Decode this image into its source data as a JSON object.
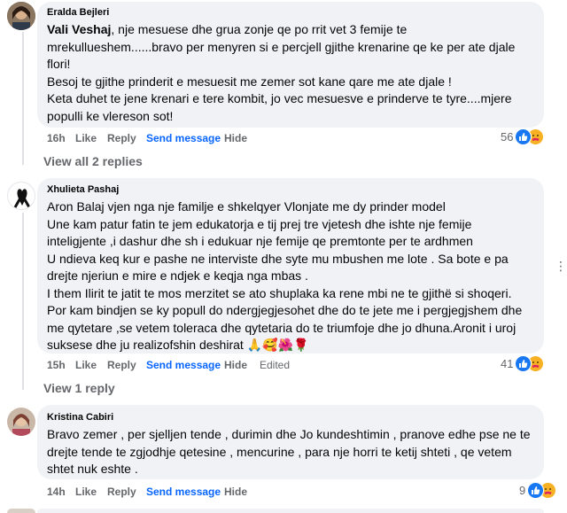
{
  "comments": [
    {
      "author": "Eralda Bejleri",
      "mention": "Vali Veshaj",
      "lines": [
        ", nje mesuese dhe grua zonje qe po rrit vet 3 femije te",
        "mrekullueshem......bravo per menyren si e percjell gjithe krenarine qe ke per ate djale",
        "flori!",
        "Besoj te gjithe prinderit e mesuesit me zemer sot kane qare me ate djale !",
        "Keta duhet te jene krenari e tere kombit, jo vec mesuesve e prinderve te tyre....mjere",
        "populli ke vlereson sot!"
      ],
      "time": "16h",
      "like": "Like",
      "reply": "Reply",
      "send": "Send message",
      "hide": "Hide",
      "reaction_count": "56",
      "reaction_icons": [
        "like-icon",
        "care-icon"
      ],
      "view_replies": "View all 2 replies"
    },
    {
      "author": "Xhulieta Pashaj",
      "lines": [
        "Aron Balaj vjen nga nje familje e shkelqyer Vlonjate me dy prinder model",
        "Une kam patur fatin te jem edukatorja e tij prej tre vjetesh dhe ishte nje femije",
        "inteligjente ,i dashur dhe sh i edukuar nje femije qe premtonte per te ardhmen",
        "U ndieva keq kur e pashe ne interviste dhe syte mu mbushen me lote . Sa bote e pa",
        "drejte njeriun e mire e ndjek e keqja nga mbas .",
        "I them Ilirit te jatit te mos merzitet se ato shuplaka ka rene mbi ne te gjithë si shoqeri.",
        "Por kam bindjen se ky popull do ndergjegjesohet dhe do te jete me i pergjegjshem dhe",
        "me qytetare ,se vetem toleraca dhe qytetaria do te triumfoje dhe jo dhuna.Aronit i uroj",
        "suksese dhe ju realizofshin deshirat 🙏🥰🌺🌹"
      ],
      "time": "15h",
      "like": "Like",
      "reply": "Reply",
      "send": "Send message",
      "hide": "Hide",
      "edited": "Edited",
      "reaction_count": "41",
      "reaction_icons": [
        "like-icon",
        "care-icon"
      ],
      "view_replies": "View 1 reply"
    },
    {
      "author": "Kristina Cabiri",
      "lines": [
        "Bravo zemer , per sjelljen tende , durimin dhe Jo kundeshtimin , pranove edhe pse ne te",
        "drejte tende te zgjodhje qetesine , mencurine , para nje horri te ketij shteti , qe vetem",
        "shtet nuk eshte ."
      ],
      "time": "14h",
      "like": "Like",
      "reply": "Reply",
      "send": "Send message",
      "hide": "Hide",
      "reaction_count": "9",
      "reaction_icons": [
        "like-icon",
        "care-icon"
      ]
    }
  ],
  "more_options_icon": "ellipsis-icon",
  "colors": {
    "bubble": "#f0f2f5",
    "link": "#0866ff",
    "meta": "#65676b",
    "like": "#1877f2",
    "care": "#f7b125"
  }
}
